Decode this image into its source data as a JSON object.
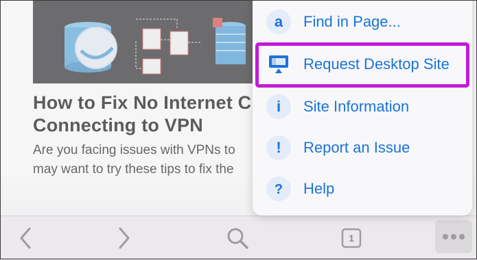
{
  "article": {
    "title": "How to Fix No Internet C\nConnecting to VPN",
    "description": "Are you facing issues with VPNs to\nmay want to try these tips to fix the"
  },
  "menu": {
    "items": [
      {
        "label": "Find in Page...",
        "icon": "find-in-page-icon"
      },
      {
        "label": "Request Desktop Site",
        "icon": "desktop-monitor-icon",
        "highlighted": true
      },
      {
        "label": "Site Information",
        "icon": "info-icon"
      },
      {
        "label": "Report an Issue",
        "icon": "exclamation-icon"
      },
      {
        "label": "Help",
        "icon": "question-icon"
      }
    ]
  },
  "toolbar": {
    "tab_count": "1",
    "buttons": [
      "back-icon",
      "forward-icon",
      "search-icon",
      "tabs-icon",
      "more-icon"
    ]
  },
  "colors": {
    "accent": "#1a73d9",
    "highlight": "#c21bd6",
    "toolbar_bg": "#ece9ec",
    "menu_bg": "#f8f8fa",
    "icon_bg": "#e3ecf8"
  }
}
